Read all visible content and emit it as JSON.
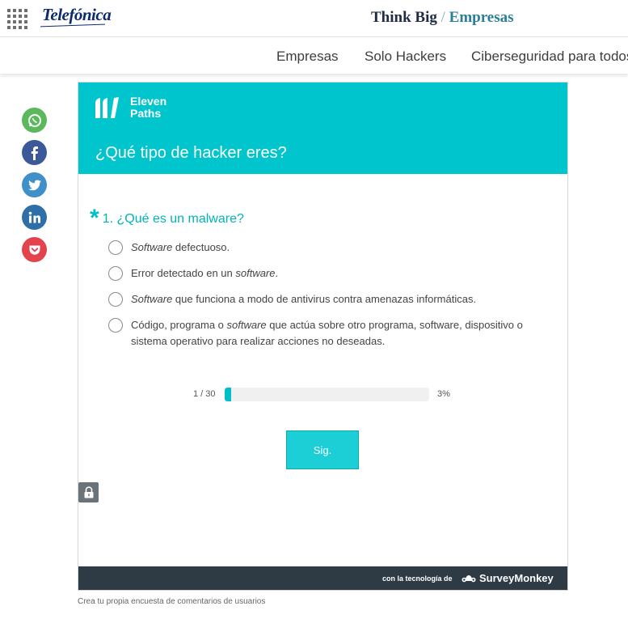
{
  "header": {
    "brand": "Telefónica",
    "think_big": "Think Big",
    "separator": "/",
    "empresas": "Empresas"
  },
  "nav": {
    "items": [
      {
        "label": "Empresas"
      },
      {
        "label": "Solo Hackers"
      },
      {
        "label": "Ciberseguridad para todos"
      }
    ]
  },
  "social": [
    {
      "icon": "whatsapp-icon",
      "color": "#5cb85c"
    },
    {
      "icon": "facebook-icon",
      "color": "#3b5998"
    },
    {
      "icon": "twitter-icon",
      "color": "#3f8fc9"
    },
    {
      "icon": "linkedin-icon",
      "color": "#2f6fa7"
    },
    {
      "icon": "pocket-icon",
      "color": "#e2434d"
    }
  ],
  "survey": {
    "logo_line1": "Eleven",
    "logo_line2": "Paths",
    "title": "¿Qué tipo de hacker eres?",
    "question": {
      "required_mark": "*",
      "text": "1. ¿Qué es un malware?",
      "options": [
        {
          "em": "Software",
          "before": "",
          "after": " defectuoso."
        },
        {
          "em": "software",
          "before": "Error detectado en un ",
          "after": "."
        },
        {
          "em": "Software",
          "before": "",
          "after": " que funciona a modo de antivirus contra amenazas informáticas."
        },
        {
          "em": "software",
          "before": "Código, programa o ",
          "after": " que actúa sobre otro programa, software, dispositivo o sistema operativo para realizar acciones no deseadas."
        }
      ]
    },
    "progress": {
      "count": "1 / 30",
      "percent_label": "3%",
      "fraction": 0.03
    },
    "next_label": "Sig.",
    "powered_by": "con la tecnología de",
    "surveymonkey": "SurveyMonkey",
    "accent": "#00c5cd"
  },
  "footer": {
    "create_link": "Crea tu propia encuesta de comentarios de usuarios"
  }
}
